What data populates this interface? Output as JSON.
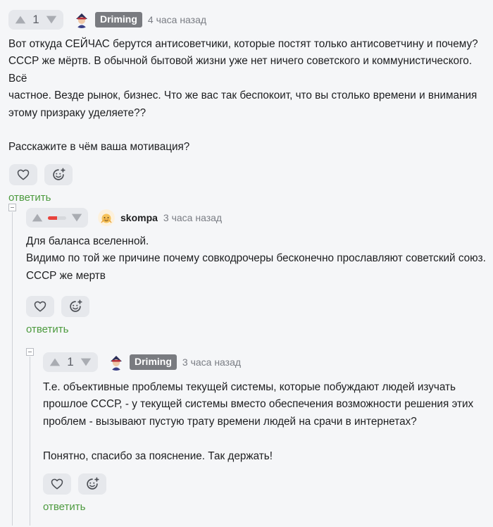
{
  "comments": [
    {
      "votes": "1",
      "author": "Driming",
      "time": "4 часа назад",
      "text": "Вот откуда СЕЙЧАС берутся антисоветчики, которые постят только антисоветчину и почему?\nСССР же мёртв. В обычной бытовой жизни уже нет ничего советского и коммунистического. Всё\nчастное. Везде рынок, бизнес. Что же вас так беспокоит, что вы столько времени и внимания\nэтому призраку уделяете??\n\nРасскажите в чём ваша мотивация?",
      "reply": "ответить"
    },
    {
      "rating_fraction": 0.5,
      "author": "skompa",
      "time": "3 часа назад",
      "text": "Для баланса вселенной.\nВидимо по той же причине почему совкодрочеры бесконечно прославляют советский союз.\nСССР же мертв",
      "reply": "ответить"
    },
    {
      "votes": "1",
      "author": "Driming",
      "time": "3 часа назад",
      "text": "Т.е. объективные проблемы текущей системы, которые побуждают людей изучать\nпрошлое СССР, - у текущей системы вместо обеспечения возможности решения этих\nпроблем - вызывают пустую трату времени людей на срачи в интернетах?\n\nПонятно, спасибо за пояснение. Так держать!",
      "reply": "ответить"
    }
  ],
  "icons": {
    "upvote": "triangle-up-icon",
    "downvote": "triangle-down-icon",
    "like": "heart-icon",
    "react": "smiley-plus-icon",
    "collapse": "minus-box-icon"
  },
  "colors": {
    "background": "#f5f6f8",
    "button_bg": "#e6e8ec",
    "badge": "#797b80",
    "reply_link": "#4c9a3e",
    "rating_negative": "#e8423c"
  }
}
